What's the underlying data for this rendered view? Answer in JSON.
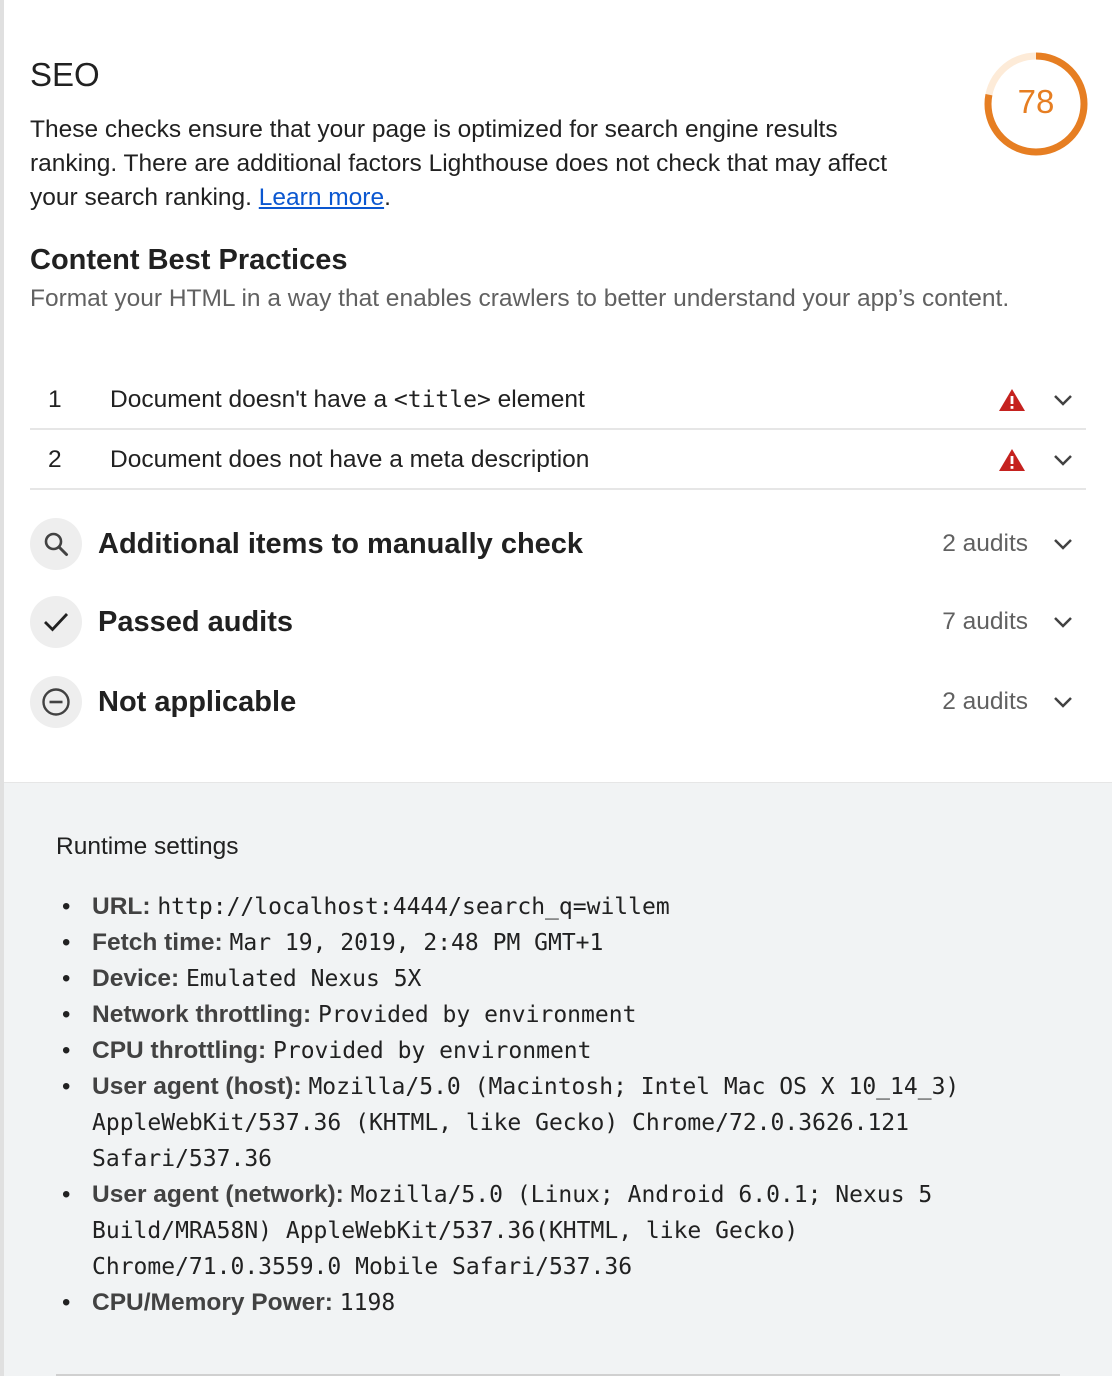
{
  "category": {
    "title": "SEO",
    "score": "78",
    "score_fraction": 0.78,
    "score_color": "#e67e22",
    "description": "These checks ensure that your page is optimized for search engine results ranking. There are additional factors Lighthouse does not check that may affect your search ranking. ",
    "learn_more": "Learn more",
    "period": "."
  },
  "group": {
    "title": "Content Best Practices",
    "description": "Format your HTML in a way that enables crawlers to better understand your app’s content."
  },
  "audits": [
    {
      "index": "1",
      "text_before": "Document doesn't have a ",
      "code": "<title>",
      "text_after": " element",
      "icon": "warning-icon"
    },
    {
      "index": "2",
      "text_before": "Document does not have a meta description",
      "code": "",
      "text_after": "",
      "icon": "warning-icon"
    }
  ],
  "clumps": [
    {
      "title": "Additional items to manually check",
      "count": "2 audits",
      "icon": "search-icon"
    },
    {
      "title": "Passed audits",
      "count": "7 audits",
      "icon": "checkmark-icon"
    },
    {
      "title": "Not applicable",
      "count": "2 audits",
      "icon": "minus-circle-icon"
    }
  ],
  "runtime": {
    "title": "Runtime settings",
    "items": [
      {
        "label": "URL:",
        "value": "http://localhost:4444/search_q=willem"
      },
      {
        "label": "Fetch time:",
        "value": "Mar 19, 2019, 2:48 PM GMT+1"
      },
      {
        "label": "Device:",
        "value": "Emulated Nexus 5X"
      },
      {
        "label": "Network throttling:",
        "value": "Provided by environment"
      },
      {
        "label": "CPU throttling:",
        "value": "Provided by environment"
      },
      {
        "label": "User agent (host):",
        "value": "Mozilla/5.0 (Macintosh; Intel Mac OS X 10_14_3) AppleWebKit/537.36 (KHTML, like Gecko) Chrome/72.0.3626.121 Safari/537.36"
      },
      {
        "label": "User agent (network):",
        "value": "Mozilla/5.0 (Linux; Android 6.0.1; Nexus 5 Build/MRA58N) AppleWebKit/537.36(KHTML, like Gecko) Chrome/71.0.3559.0 Mobile Safari/537.36"
      },
      {
        "label": "CPU/Memory Power:",
        "value": "1198"
      }
    ]
  }
}
